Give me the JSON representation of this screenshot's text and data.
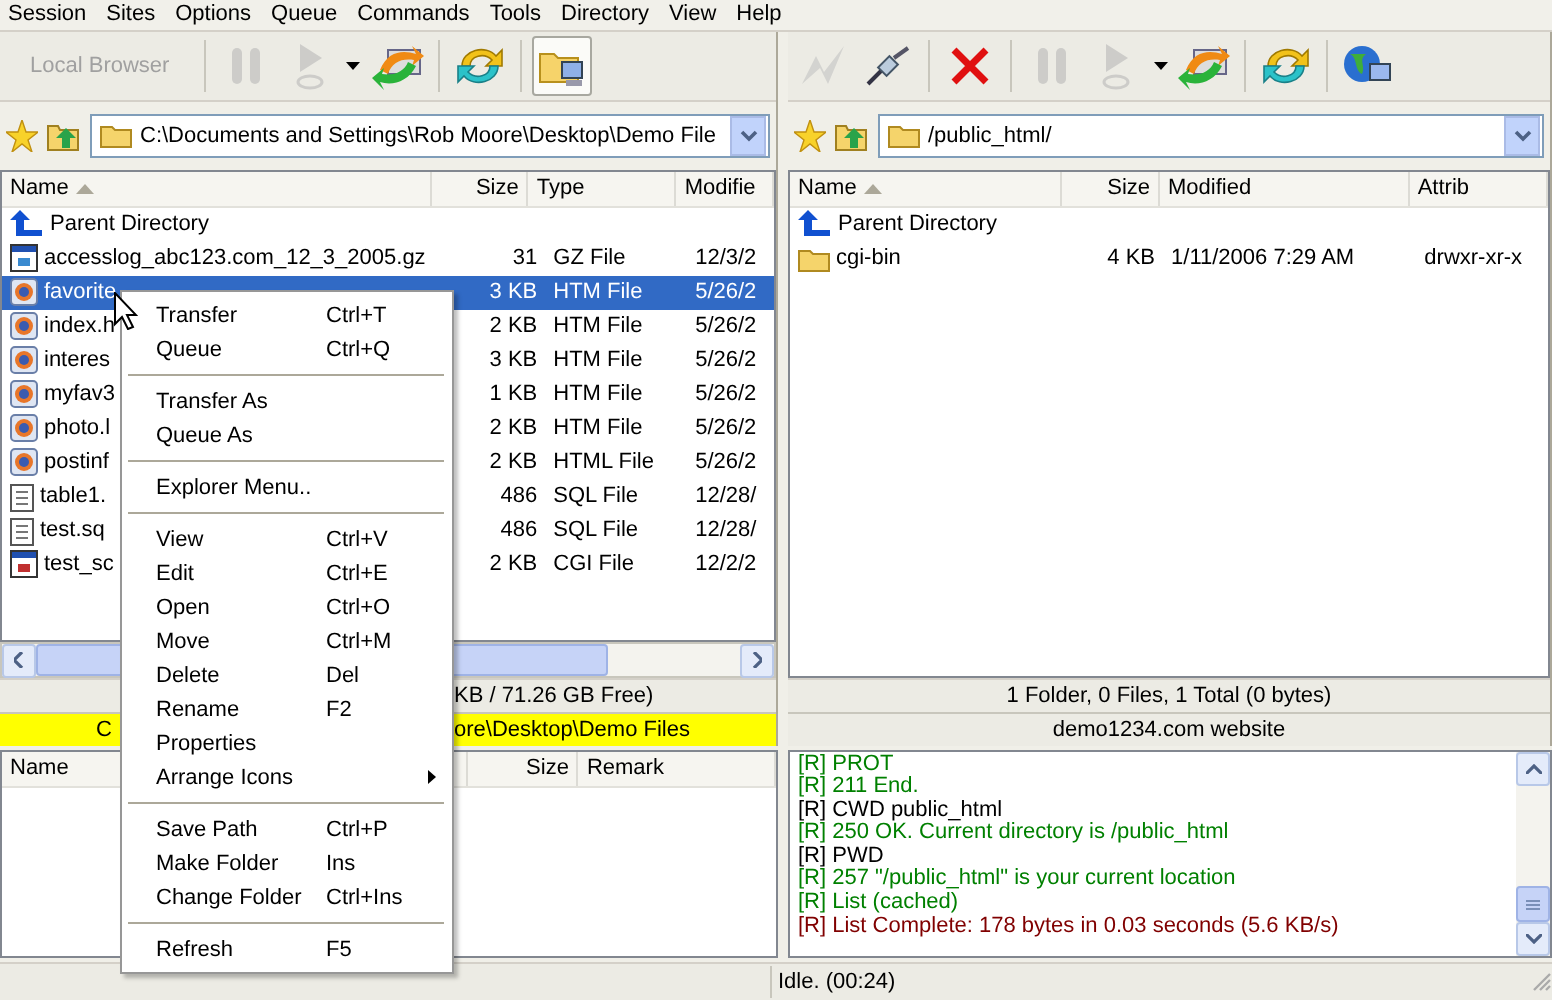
{
  "menu_bar": [
    "Session",
    "Sites",
    "Options",
    "Queue",
    "Commands",
    "Tools",
    "Directory",
    "View",
    "Help"
  ],
  "local": {
    "toolbar": [
      {
        "kind": "label",
        "label": "Local Browser",
        "disabled": true
      },
      {
        "kind": "separator"
      },
      {
        "kind": "pause",
        "disabled": true
      },
      {
        "kind": "go",
        "disabled": true
      },
      {
        "kind": "dropdown",
        "disabled": false
      },
      {
        "kind": "transfer",
        "disabled": false
      },
      {
        "kind": "separator"
      },
      {
        "kind": "refresh",
        "disabled": false
      },
      {
        "kind": "separator"
      },
      {
        "kind": "explorer",
        "disabled": false,
        "pressed": true
      }
    ],
    "path": "C:\\Documents and Settings\\Rob Moore\\Desktop\\Demo File",
    "columns": [
      {
        "label": "Name",
        "sorted": true
      },
      {
        "label": "Size"
      },
      {
        "label": "Type"
      },
      {
        "label": "Modifie"
      }
    ],
    "rows": [
      {
        "kind": "parent",
        "cells": [
          "Parent Directory"
        ],
        "selected": false
      },
      {
        "kind": "archive",
        "cells": [
          "accesslog_abc123.com_12_3_2005.gz",
          "31",
          "GZ File",
          "12/3/2"
        ],
        "selected": false
      },
      {
        "kind": "web",
        "cells": [
          "favorite",
          "3 KB",
          "HTM File",
          "5/26/2"
        ],
        "selected": true
      },
      {
        "kind": "web",
        "cells": [
          "index.h",
          "2 KB",
          "HTM File",
          "5/26/2"
        ],
        "selected": false
      },
      {
        "kind": "web",
        "cells": [
          "interes",
          "3 KB",
          "HTM File",
          "5/26/2"
        ],
        "selected": false
      },
      {
        "kind": "web",
        "cells": [
          "myfav3",
          "1 KB",
          "HTM File",
          "5/26/2"
        ],
        "selected": false
      },
      {
        "kind": "web",
        "cells": [
          "photo.l",
          "2 KB",
          "HTM File",
          "5/26/2"
        ],
        "selected": false
      },
      {
        "kind": "web",
        "cells": [
          "postinf",
          "2 KB",
          "HTML File",
          "5/26/2"
        ],
        "selected": false
      },
      {
        "kind": "text",
        "cells": [
          "table1.",
          "486",
          "SQL File",
          "12/28/"
        ],
        "selected": false
      },
      {
        "kind": "text",
        "cells": [
          "test.sq",
          "486",
          "SQL File",
          "12/28/"
        ],
        "selected": false
      },
      {
        "kind": "script",
        "cells": [
          "test_sc",
          "2 KB",
          "CGI File",
          "12/2/2"
        ],
        "selected": false
      }
    ],
    "status": "KB / 71.26 GB Free)",
    "location": [
      "C",
      "ore\\Desktop\\Demo Files"
    ]
  },
  "remote": {
    "toolbar": [
      {
        "kind": "lightning",
        "disabled": true
      },
      {
        "kind": "connect",
        "disabled": false
      },
      {
        "kind": "separator"
      },
      {
        "kind": "cancel",
        "disabled": false
      },
      {
        "kind": "separator"
      },
      {
        "kind": "pause",
        "disabled": true
      },
      {
        "kind": "go",
        "disabled": true
      },
      {
        "kind": "dropdown",
        "disabled": false
      },
      {
        "kind": "transfer",
        "disabled": false
      },
      {
        "kind": "separator"
      },
      {
        "kind": "refresh",
        "disabled": false
      },
      {
        "kind": "separator"
      },
      {
        "kind": "globe",
        "disabled": false
      }
    ],
    "path": "/public_html/",
    "columns": [
      {
        "label": "Name",
        "sorted": true
      },
      {
        "label": "Size"
      },
      {
        "label": "Modified"
      },
      {
        "label": "Attrib"
      }
    ],
    "rows": [
      {
        "kind": "parent",
        "cells": [
          "Parent Directory"
        ],
        "selected": false
      },
      {
        "kind": "folder",
        "cells": [
          "cgi-bin",
          "4 KB",
          "1/11/2006 7:29 AM",
          "drwxr-xr-x"
        ],
        "selected": false
      }
    ],
    "status": "1 Folder, 0 Files, 1 Total (0 bytes)",
    "location": "demo1234.com website"
  },
  "queue": {
    "columns": [
      "Name",
      "Size",
      "Remark"
    ]
  },
  "log": [
    {
      "text": "[R] PROT",
      "color": "#008000"
    },
    {
      "text": "[R] 211 End.",
      "color": "#008000"
    },
    {
      "text": "[R] CWD public_html",
      "color": "#000000"
    },
    {
      "text": "[R] 250 OK. Current directory is /public_html",
      "color": "#008000"
    },
    {
      "text": "[R] PWD",
      "color": "#000000"
    },
    {
      "text": "[R] 257 \"/public_html\" is your current location",
      "color": "#008000"
    },
    {
      "text": "[R] List (cached)",
      "color": "#008000"
    },
    {
      "text": "[R] List Complete: 178 bytes in 0.03 seconds (5.6 KB/s)",
      "color": "#800000"
    }
  ],
  "status_bar": "Idle. (00:24)",
  "context_menu": [
    {
      "kind": "item",
      "label": "Transfer",
      "shortcut": "Ctrl+T"
    },
    {
      "kind": "item",
      "label": "Queue",
      "shortcut": "Ctrl+Q"
    },
    {
      "kind": "separator"
    },
    {
      "kind": "item",
      "label": "Transfer As"
    },
    {
      "kind": "item",
      "label": "Queue As"
    },
    {
      "kind": "separator"
    },
    {
      "kind": "item",
      "label": "Explorer Menu.."
    },
    {
      "kind": "separator"
    },
    {
      "kind": "item",
      "label": "View",
      "shortcut": "Ctrl+V"
    },
    {
      "kind": "item",
      "label": "Edit",
      "shortcut": "Ctrl+E"
    },
    {
      "kind": "item",
      "label": "Open",
      "shortcut": "Ctrl+O"
    },
    {
      "kind": "item",
      "label": "Move",
      "shortcut": "Ctrl+M"
    },
    {
      "kind": "item",
      "label": "Delete",
      "shortcut": "Del"
    },
    {
      "kind": "item",
      "label": "Rename",
      "shortcut": "F2"
    },
    {
      "kind": "item",
      "label": "Properties"
    },
    {
      "kind": "item",
      "label": "Arrange Icons",
      "submenu": true
    },
    {
      "kind": "separator"
    },
    {
      "kind": "item",
      "label": "Save Path",
      "shortcut": "Ctrl+P"
    },
    {
      "kind": "item",
      "label": "Make Folder",
      "shortcut": "Ins"
    },
    {
      "kind": "item",
      "label": "Change Folder",
      "shortcut": "Ctrl+Ins"
    },
    {
      "kind": "separator"
    },
    {
      "kind": "item",
      "label": "Refresh",
      "shortcut": "F5"
    }
  ]
}
